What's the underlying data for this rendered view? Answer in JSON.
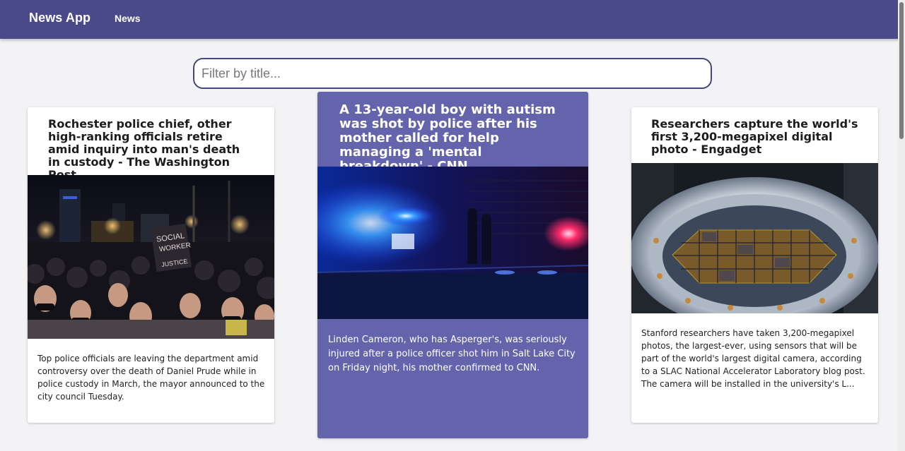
{
  "app": {
    "title": "News App",
    "nav": [
      "News"
    ]
  },
  "filter": {
    "placeholder": "Filter by title...",
    "value": ""
  },
  "articles": [
    {
      "title": "Rochester police chief, other high-ranking officials retire amid inquiry into man's death in custody - The Washington Post",
      "image_alt": "Protest crowd at night holding a 'Social Worker for Social Justice' sign",
      "description": "Top police officials are leaving the department amid controversy over the death of Daniel Prude while in police custody in March, the mayor announced to the city council Tuesday."
    },
    {
      "title": "A 13-year-old boy with autism was shot by police after his mother called for help managing a 'mental breakdown' - CNN",
      "image_alt": "Police car lights at night",
      "description": "Linden Cameron, who has Asperger's, was seriously injured after a police officer shot him in Salt Lake City on Friday night, his mother confirmed to CNN."
    },
    {
      "title": "Researchers capture the world's first 3,200-megapixel digital photo - Engadget",
      "image_alt": "Large digital camera sensor array",
      "description": "Stanford researchers have taken 3,200-megapixel photos, the largest-ever, using sensors that will be part of the world's largest digital camera, according to a SLAC National Accelerator Laboratory blog post. The camera will be installed in the university's L..."
    }
  ],
  "theme": {
    "appbar": "#4a4a8a",
    "highlight_card": "#6464ac",
    "background": "#f3f3f5"
  }
}
